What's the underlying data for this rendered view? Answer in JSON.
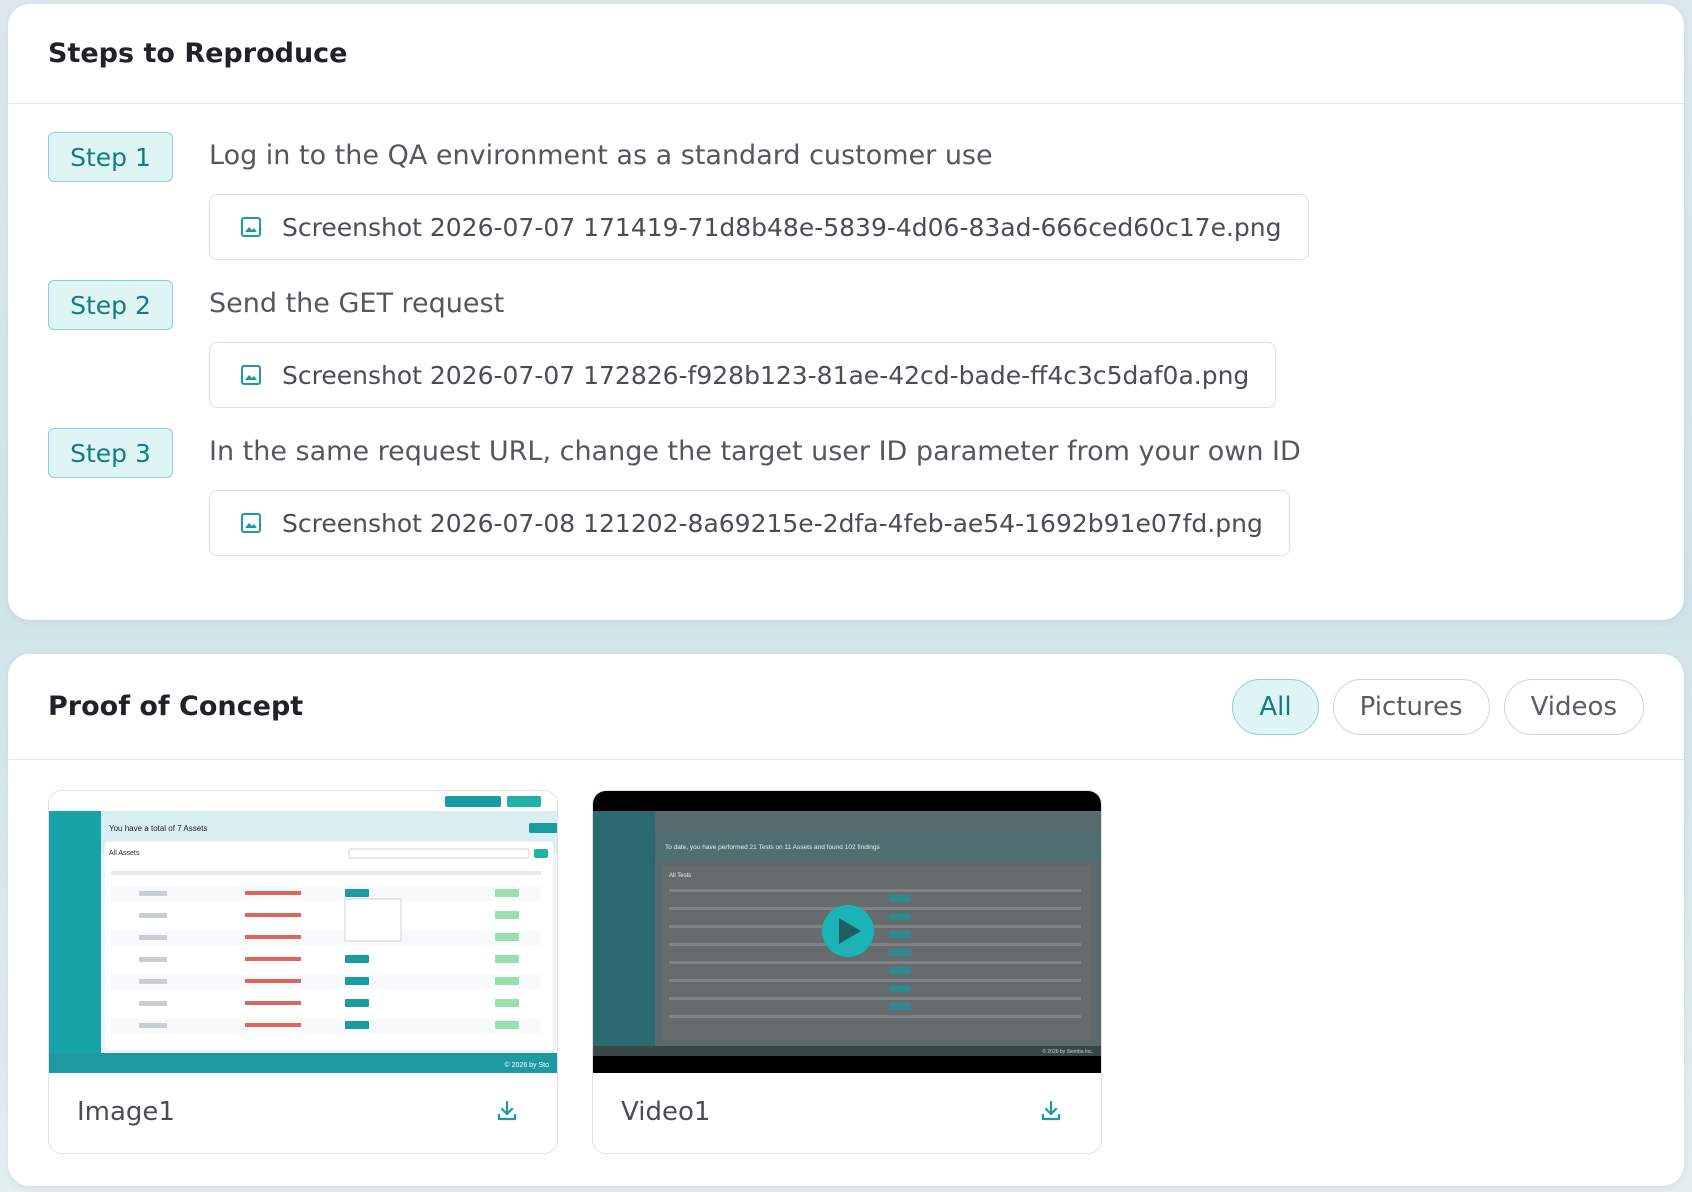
{
  "steps_section": {
    "title": "Steps to Reproduce",
    "steps": [
      {
        "badge": "Step 1",
        "text": "Log in to the QA environment as a standard customer use",
        "attachment": "Screenshot 2026-07-07 171419-71d8b48e-5839-4d06-83ad-666ced60c17e.png"
      },
      {
        "badge": "Step 2",
        "text": "Send the GET request",
        "attachment": "Screenshot 2026-07-07 172826-f928b123-81ae-42cd-bade-ff4c3c5daf0a.png"
      },
      {
        "badge": "Step 3",
        "text": "In the same request URL, change the target user ID parameter from your own ID",
        "attachment": "Screenshot 2026-07-08 121202-8a69215e-2dfa-4feb-ae54-1692b91e07fd.png"
      }
    ]
  },
  "poc_section": {
    "title": "Proof of Concept",
    "filters": [
      "All",
      "Pictures",
      "Videos"
    ],
    "active_filter": "All",
    "media": [
      {
        "name": "Image1",
        "type": "image",
        "thumb_banner": "You have a total of 7 Assets",
        "thumb_heading": "All Assets",
        "thumb_footer": "© 2026 by Sto"
      },
      {
        "name": "Video1",
        "type": "video",
        "thumb_banner": "To date, you have performed 21 Tests on 11 Assets and found 102 findings",
        "thumb_heading": "All Tests",
        "thumb_footer": "© 2026 by Siemba Inc."
      }
    ]
  },
  "colors": {
    "accent": "#117e85",
    "accent_bg": "#dff4f5",
    "accent_border": "#8ad2d6"
  },
  "icons": {
    "attachment": "image-file-icon",
    "download": "download-icon",
    "play": "play-icon"
  }
}
